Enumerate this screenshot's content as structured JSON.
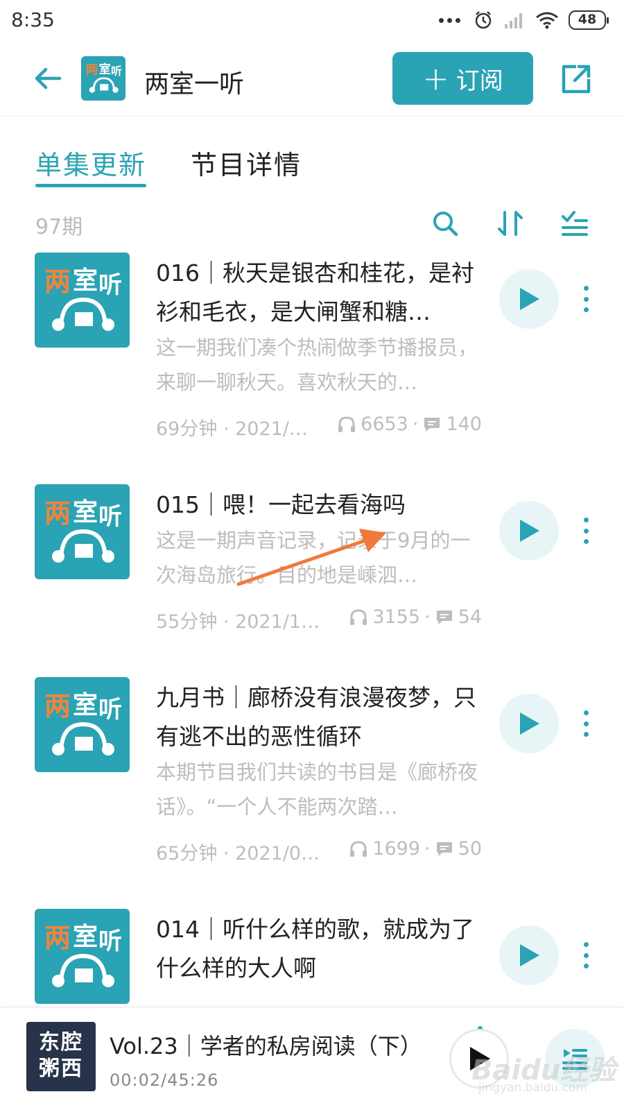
{
  "status_bar": {
    "time": "8:35",
    "battery": "48"
  },
  "header": {
    "title": "两室一听",
    "subscribe_label": "订阅",
    "subscribe_plus": "+"
  },
  "tabs": [
    {
      "label": "单集更新",
      "active": true
    },
    {
      "label": "节目详情",
      "active": false
    }
  ],
  "toolbar": {
    "episode_count": "97期"
  },
  "episodes": [
    {
      "title": "016｜秋天是银杏和桂花，是衬衫和毛衣，是大闸蟹和糖…",
      "description": "这一期我们凑个热闹做季节播报员，来聊一聊秋天。喜欢秋天的…",
      "duration_date": "69分钟 · 2021/…",
      "plays": "6653",
      "comments": "140"
    },
    {
      "title": "015｜喂！一起去看海吗",
      "description": "这是一期声音记录，记录于9月的一次海岛旅行。目的地是嵊泗…",
      "duration_date": "55分钟 · 2021/1…",
      "plays": "3155",
      "comments": "54"
    },
    {
      "title": "九月书｜廊桥没有浪漫夜梦，只有逃不出的恶性循环",
      "description": "本期节目我们共读的书目是《廊桥夜话》。“一个人不能两次踏…",
      "duration_date": "65分钟 · 2021/0…",
      "plays": "1699",
      "comments": "50"
    },
    {
      "title": "014｜听什么样的歌，就成为了什么样的大人啊"
    }
  ],
  "mini_player": {
    "cover_text_line1": "东腔",
    "cover_text_line2": "粥西",
    "title": "Vol.23｜学者的私房阅读（下）",
    "time": "00:02/45:26"
  },
  "watermark": {
    "text": "Baidu经验",
    "sub": "jingyan.baidu.com"
  },
  "colors": {
    "accent": "#2aa3b4",
    "arrow": "#f07a3a",
    "play_bg": "#e7f5f7",
    "muted_text": "#bdbdbd"
  },
  "icons": {
    "back": "arrow-left-icon",
    "share": "share-icon",
    "search": "search-icon",
    "sort": "sort-icon",
    "batch": "checklist-icon",
    "play": "play-icon",
    "more": "more-vertical-icon",
    "headphones": "headphones-icon",
    "comment": "comment-icon",
    "playlist": "playlist-icon"
  }
}
